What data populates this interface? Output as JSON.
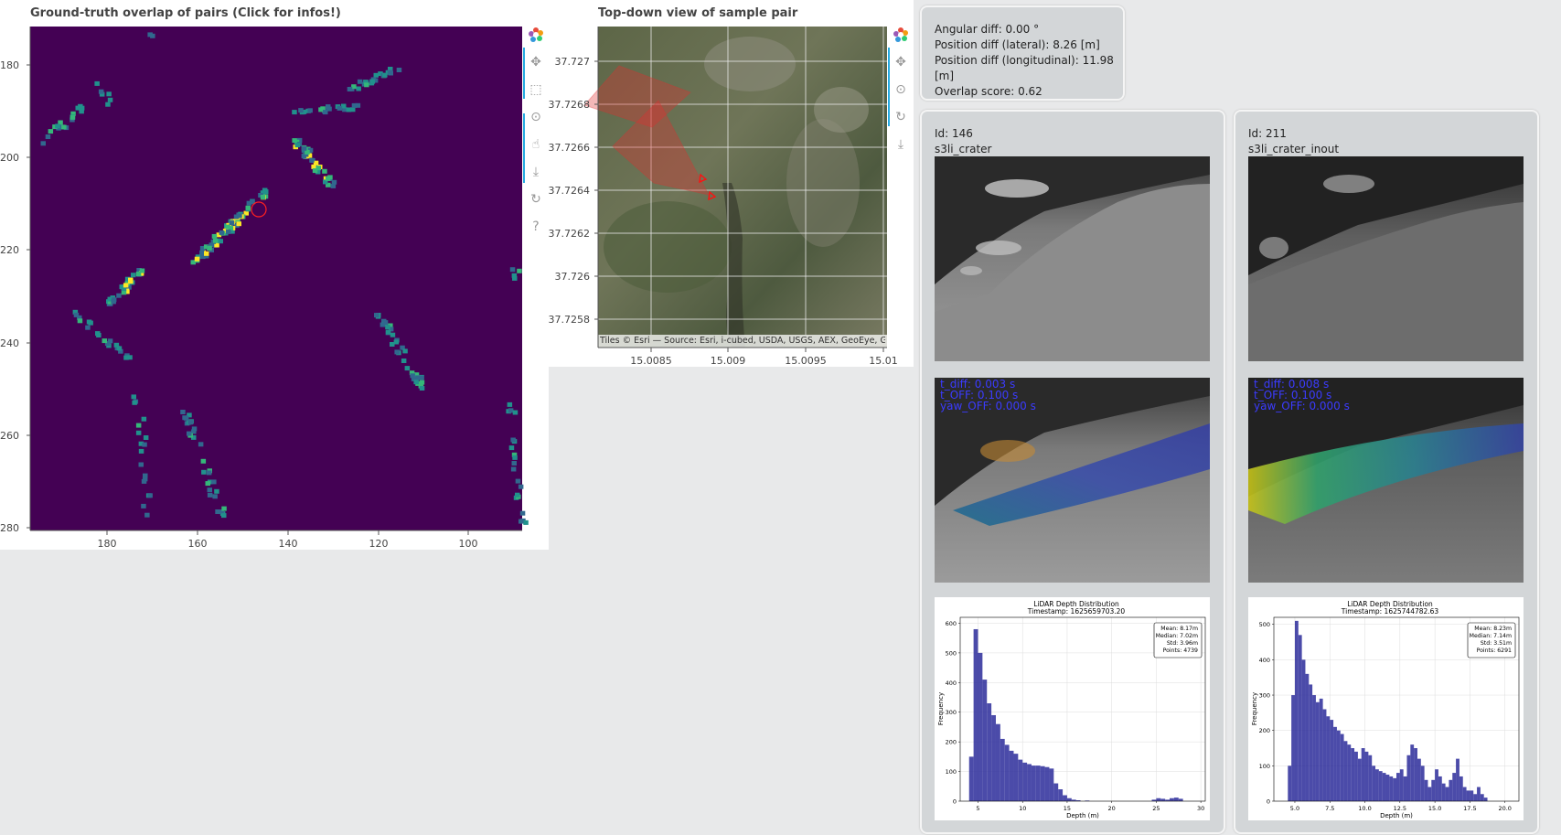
{
  "heatmap_panel": {
    "title": "Ground-truth overlap of pairs (Click for infos!)",
    "y_ticks": [
      "180",
      "200",
      "220",
      "240",
      "260",
      "280"
    ],
    "x_ticks": [
      "180",
      "160",
      "140",
      "120",
      "100"
    ],
    "colors": {
      "background": "#440154",
      "low": "#31688e",
      "mid": "#35b779",
      "high": "#fde725"
    }
  },
  "map_panel": {
    "title": "Top-down view of sample pair",
    "y_ticks": [
      "37.727",
      "37.7268",
      "37.7266",
      "37.7264",
      "37.7262",
      "37.726",
      "37.7258"
    ],
    "x_ticks": [
      "15.0085",
      "15.009",
      "15.0095",
      "15.01"
    ],
    "attribution": "Tiles © Esri — Source: Esri, i-cubed, USDA, USGS, AEX, GeoEye, Getmap..."
  },
  "toolbar_icons": [
    "bokeh-logo-icon",
    "pan-icon",
    "box-zoom-icon",
    "wheel-zoom-icon",
    "tap-icon",
    "save-icon",
    "reset-icon",
    "help-icon"
  ],
  "map_toolbar_icons": [
    "bokeh-logo-icon",
    "pan-icon",
    "wheel-zoom-icon",
    "reset-icon",
    "save-icon"
  ],
  "info": {
    "angular": "Angular diff: 0.00 °",
    "lateral": "Position diff (lateral): 8.26 [m]",
    "longitudinal": "Position diff (longitudinal): 11.98 [m]",
    "overlap": "Overlap score: 0.62"
  },
  "left_card": {
    "id": "Id: 146",
    "name": "s3li_crater",
    "overlay_lines": [
      "t_diff: 0.003 s",
      "t_OFF: 0.100 s",
      "yaw_OFF: 0.000 s"
    ],
    "hist": {
      "title": "LiDAR Depth Distribution",
      "subtitle": "Timestamp: 1625659703.20",
      "stats": [
        "Mean: 8.17m",
        "Median: 7.02m",
        "Std: 3.96m",
        "Points: 4739"
      ],
      "xlabel": "Depth (m)",
      "ylabel": "Frequency",
      "x_ticks": [
        "5",
        "10",
        "15",
        "20",
        "25",
        "30"
      ],
      "y_ticks": [
        "0",
        "100",
        "200",
        "300",
        "400",
        "500",
        "600"
      ]
    }
  },
  "right_card": {
    "id": "Id: 211",
    "name": "s3li_crater_inout",
    "overlay_lines": [
      "t_diff: 0.008 s",
      "t_OFF: 0.100 s",
      "yaw_OFF: 0.000 s"
    ],
    "hist": {
      "title": "LiDAR Depth Distribution",
      "subtitle": "Timestamp: 1625744782.63",
      "stats": [
        "Mean: 8.23m",
        "Median: 7.14m",
        "Std: 3.51m",
        "Points: 6291"
      ],
      "xlabel": "Depth (m)",
      "ylabel": "Frequency",
      "x_ticks": [
        "5.0",
        "7.5",
        "10.0",
        "12.5",
        "15.0",
        "17.5",
        "20.0"
      ],
      "y_ticks": [
        "0",
        "100",
        "200",
        "300",
        "400",
        "500"
      ]
    }
  },
  "chart_data": [
    {
      "type": "bar",
      "title": "LiDAR Depth Distribution",
      "subtitle": "Timestamp: 1625659703.20",
      "xlabel": "Depth (m)",
      "ylabel": "Frequency",
      "xlim": [
        3,
        30.5
      ],
      "ylim": [
        0,
        620
      ],
      "x": [
        4,
        4.5,
        5,
        5.5,
        6,
        6.5,
        7,
        7.5,
        8,
        8.5,
        9,
        9.5,
        10,
        10.5,
        11,
        11.5,
        12,
        12.5,
        13,
        13.5,
        14,
        14.5,
        15,
        15.5,
        16,
        17,
        24.5,
        25,
        25.5,
        26,
        26.5,
        27,
        27.5
      ],
      "values": [
        150,
        580,
        500,
        410,
        330,
        290,
        260,
        210,
        190,
        170,
        160,
        140,
        130,
        125,
        120,
        120,
        118,
        115,
        110,
        60,
        40,
        20,
        10,
        5,
        3,
        2,
        5,
        10,
        8,
        5,
        10,
        12,
        8
      ]
    },
    {
      "type": "bar",
      "title": "LiDAR Depth Distribution",
      "subtitle": "Timestamp: 1625744782.63",
      "xlabel": "Depth (m)",
      "ylabel": "Frequency",
      "xlim": [
        3.5,
        21
      ],
      "ylim": [
        0,
        520
      ],
      "x": [
        4.5,
        4.75,
        5,
        5.25,
        5.5,
        5.75,
        6,
        6.25,
        6.5,
        6.75,
        7,
        7.25,
        7.5,
        7.75,
        8,
        8.25,
        8.5,
        8.75,
        9,
        9.25,
        9.5,
        9.75,
        10,
        10.25,
        10.5,
        10.75,
        11,
        11.25,
        11.5,
        11.75,
        12,
        12.25,
        12.5,
        12.75,
        13,
        13.25,
        13.5,
        13.75,
        14,
        14.25,
        14.5,
        14.75,
        15,
        15.25,
        15.5,
        15.75,
        16,
        16.25,
        16.5,
        16.75,
        17,
        17.25,
        17.5,
        17.75,
        18,
        18.25,
        18.5
      ],
      "values": [
        100,
        300,
        510,
        470,
        400,
        360,
        330,
        300,
        280,
        290,
        260,
        240,
        230,
        210,
        200,
        190,
        170,
        160,
        150,
        140,
        120,
        150,
        140,
        130,
        100,
        90,
        85,
        80,
        75,
        70,
        65,
        80,
        90,
        70,
        130,
        160,
        150,
        120,
        100,
        60,
        40,
        60,
        90,
        70,
        50,
        40,
        60,
        80,
        120,
        70,
        40,
        30,
        30,
        20,
        40,
        20,
        10
      ]
    }
  ]
}
